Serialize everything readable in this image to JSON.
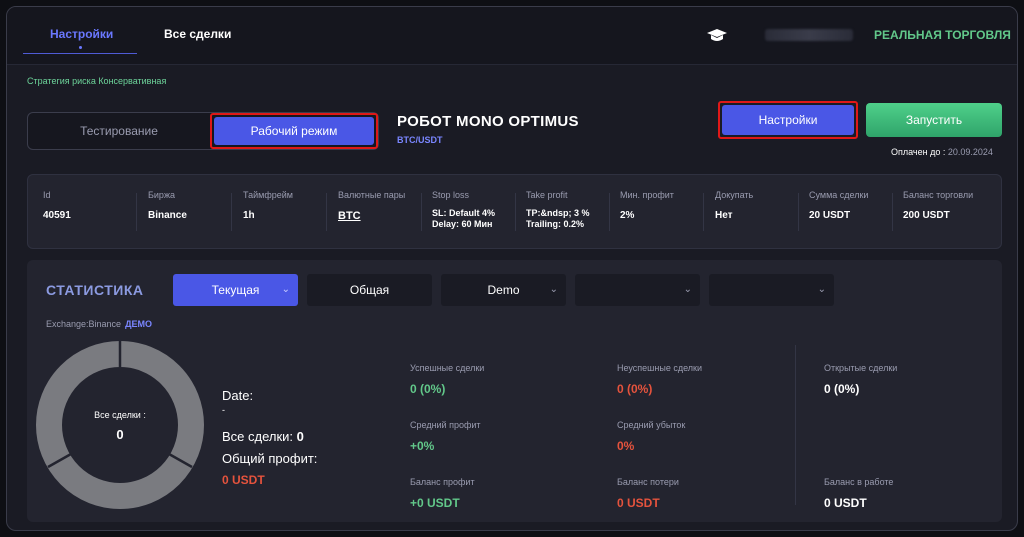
{
  "topbar": {
    "tabs": [
      {
        "label": "Настройки"
      },
      {
        "label": "Все сделки"
      }
    ],
    "mode_label": "РЕАЛЬНАЯ ТОРГОВЛЯ"
  },
  "strategy_label": "Стратегия риска Консервативная",
  "mode_toggle": {
    "test_label": "Тестирование",
    "work_label": "Рабочий режим"
  },
  "robot": {
    "title": "РОБОТ MONO OPTIMUS",
    "pair": "BTC/USDT"
  },
  "actions": {
    "settings_label": "Настройки",
    "start_label": "Запустить"
  },
  "paid": {
    "label": "Оплачен до :",
    "date": "20.09.2024"
  },
  "info": [
    {
      "label": "Id",
      "value": "40591"
    },
    {
      "label": "Биржа",
      "value": "Binance"
    },
    {
      "label": "Таймфрейм",
      "value": "1h"
    },
    {
      "label": "Валютные пары",
      "value": "BTC"
    },
    {
      "label": "Stop loss",
      "line1": "SL:  Default 4%",
      "line2": "Delay:  60 Мин"
    },
    {
      "label": "Take profit",
      "line1": "TP:&ndsp; 3 %",
      "line2": "Trailing: 0.2%"
    },
    {
      "label": "Мин. профит",
      "value": "2%"
    },
    {
      "label": "Докупать",
      "value": "Нет"
    },
    {
      "label": "Сумма сделки",
      "value": "20 USDT"
    },
    {
      "label": "Баланс торговли",
      "value": "200 USDT"
    }
  ],
  "stats": {
    "title": "СТАТИСТИКА",
    "selects": {
      "current": "Текущая",
      "total": "Общая",
      "demo": "Demo"
    },
    "exchange": {
      "label": "Exchange:Binance",
      "badge": "ДЕМО"
    },
    "donut": {
      "label": "Все сделки :",
      "value": "0"
    },
    "date_label": "Date:",
    "date_value": "-",
    "all_deals_label": "Все сделки:",
    "all_deals_value": "0",
    "total_profit_label": "Общий профит:",
    "total_profit_value": "0 USDT",
    "metrics": [
      {
        "label": "Успешные сделки",
        "value": "0 (0%)",
        "color": "green"
      },
      {
        "label": "Неуспешные сделки",
        "value": "0 (0%)",
        "color": "red"
      },
      {
        "label": "Открытые сделки",
        "value": "0 (0%)",
        "color": "white"
      },
      {
        "label": "Средний профит",
        "value": "+0%",
        "color": "green"
      },
      {
        "label": "Средний убыток",
        "value": "0%",
        "color": "red"
      },
      {
        "label": "Баланс профит",
        "value": "+0 USDT",
        "color": "green"
      },
      {
        "label": "Баланс потери",
        "value": "0 USDT",
        "color": "red"
      },
      {
        "label": "Баланс в работе",
        "value": "0 USDT",
        "color": "white"
      }
    ]
  }
}
